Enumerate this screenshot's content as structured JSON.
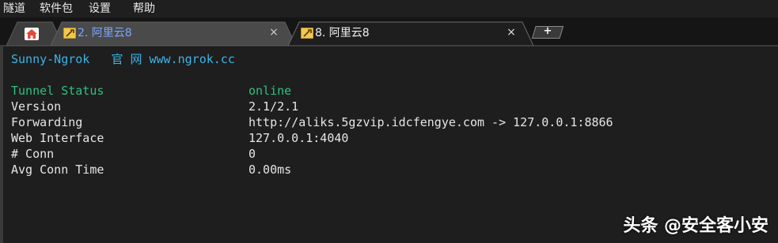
{
  "menu": [
    "隧道",
    "软件包",
    "设置",
    "帮助"
  ],
  "tabs": [
    {
      "label": "2. 阿里云8",
      "close": "×"
    },
    {
      "label": "8. 阿里云8",
      "close": "×"
    }
  ],
  "new_tab_label": "+",
  "terminal": {
    "brand": "Sunny-Ngrok",
    "official_site_label": "官 网",
    "site_url": "www.ngrok.cc",
    "status": {
      "label": "Tunnel Status",
      "value": "online"
    },
    "rows": [
      {
        "label": "Version",
        "value": "2.1/2.1"
      },
      {
        "label": "Forwarding",
        "value": "http://aliks.5gzvip.idcfengye.com -> 127.0.0.1:8866"
      },
      {
        "label": "Web Interface",
        "value": "127.0.0.1:4040"
      },
      {
        "label": "# Conn",
        "value": "0"
      },
      {
        "label": "Avg Conn Time",
        "value": "0.00ms"
      }
    ]
  },
  "watermark": "头条 @安全客小安",
  "icons": {
    "home_tab": "home-icon",
    "tab_type": "tool-icon",
    "close": "close-icon"
  },
  "colors": {
    "accent_cyan": "#3cb4e6",
    "status_green": "#2ec27e",
    "home_icon": "#e04a3b",
    "tool_icon_bg": "#f2c84b"
  }
}
